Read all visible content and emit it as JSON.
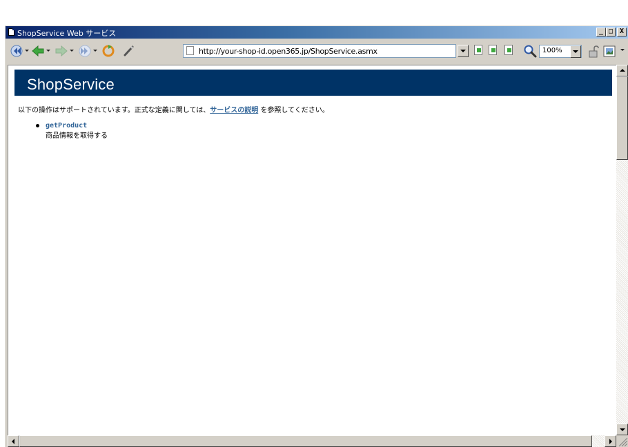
{
  "window": {
    "title": "ShopService Web サービス",
    "caption_buttons": {
      "minimize": "_",
      "maximize": "□",
      "close": "X"
    }
  },
  "toolbar": {
    "buttons": [
      {
        "name": "rewind",
        "icon": "rewind-icon"
      },
      {
        "name": "back",
        "icon": "back-arrow-icon"
      },
      {
        "name": "forward",
        "icon": "forward-arrow-icon"
      },
      {
        "name": "fast-forward",
        "icon": "fast-forward-icon"
      },
      {
        "name": "refresh",
        "icon": "refresh-icon"
      },
      {
        "name": "edit",
        "icon": "pen-icon"
      }
    ],
    "address": "http://your-shop-id.open365.jp/ShopService.asmx",
    "zoom": "100%"
  },
  "page": {
    "heading": "ShopService",
    "intro_before": "以下の操作はサポートされています。正式な定義に関しては、",
    "intro_link": "サービスの説明",
    "intro_after": " を参照してください。",
    "operations": [
      {
        "name": "getProduct",
        "description": "商品情報を取得する"
      }
    ]
  },
  "colors": {
    "heading_bg": "#003366",
    "link": "#336699",
    "title_bar_start": "#0a246a",
    "title_bar_end": "#a6caf0",
    "chrome": "#d4d0c8"
  }
}
